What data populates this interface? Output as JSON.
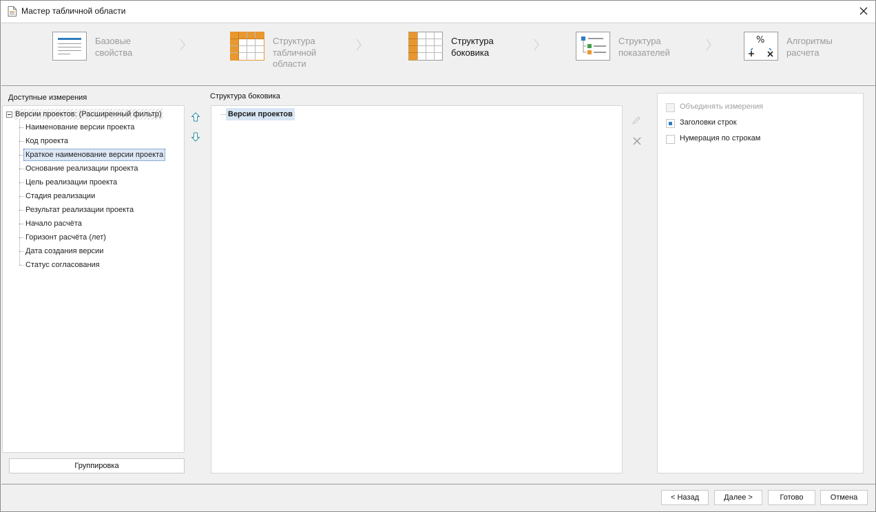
{
  "window": {
    "title": "Мастер табличной области",
    "icon": "document-icon",
    "close_icon": "close-icon"
  },
  "steps": [
    {
      "label": "Базовые\nсвойства",
      "state": "done",
      "icon": "basic-properties-icon"
    },
    {
      "label": "Структура\nтабличной\nобласти",
      "state": "done",
      "icon": "table-structure-icon"
    },
    {
      "label": "Структура\nбоковика",
      "state": "active",
      "icon": "sidebar-structure-icon"
    },
    {
      "label": "Структура\nпоказателей",
      "state": "upcoming",
      "icon": "indicators-structure-icon"
    },
    {
      "label": "Алгоритмы\nрасчета",
      "state": "upcoming",
      "icon": "calculation-algorithms-icon"
    }
  ],
  "available": {
    "label": "Доступные измерения",
    "root": "Версии проектов: (Расширенный фильтр)",
    "items": [
      "Наименование версии проекта",
      "Код проекта",
      "Краткое наименование версии проекта",
      "Основание реализации проекта",
      "Цель реализации проекта",
      "Стадия реализации",
      "Результат реализации проекта",
      "Начало расчёта",
      "Горизонт расчёта (лет)",
      "Дата создания версии",
      "Статус согласования"
    ],
    "selected_index": 2,
    "group_button": "Группировка"
  },
  "structure": {
    "label": "Структура боковика",
    "items": [
      "Версии проектов"
    ]
  },
  "options": {
    "merge_dimensions": {
      "label": "Объединять измерения",
      "checked": false,
      "enabled": false
    },
    "row_headers": {
      "label": "Заголовки строк",
      "checked": true,
      "enabled": true
    },
    "row_numbering": {
      "label": "Нумерация по строкам",
      "checked": false,
      "enabled": true
    }
  },
  "footer": {
    "back": "< Назад",
    "next": "Далее >",
    "done": "Готово",
    "cancel": "Отмена"
  },
  "colors": {
    "accent_orange": "#e8982e",
    "accent_blue": "#2e7dc1",
    "accent_green": "#43a047",
    "arrow_teal": "#2a8fa0"
  }
}
